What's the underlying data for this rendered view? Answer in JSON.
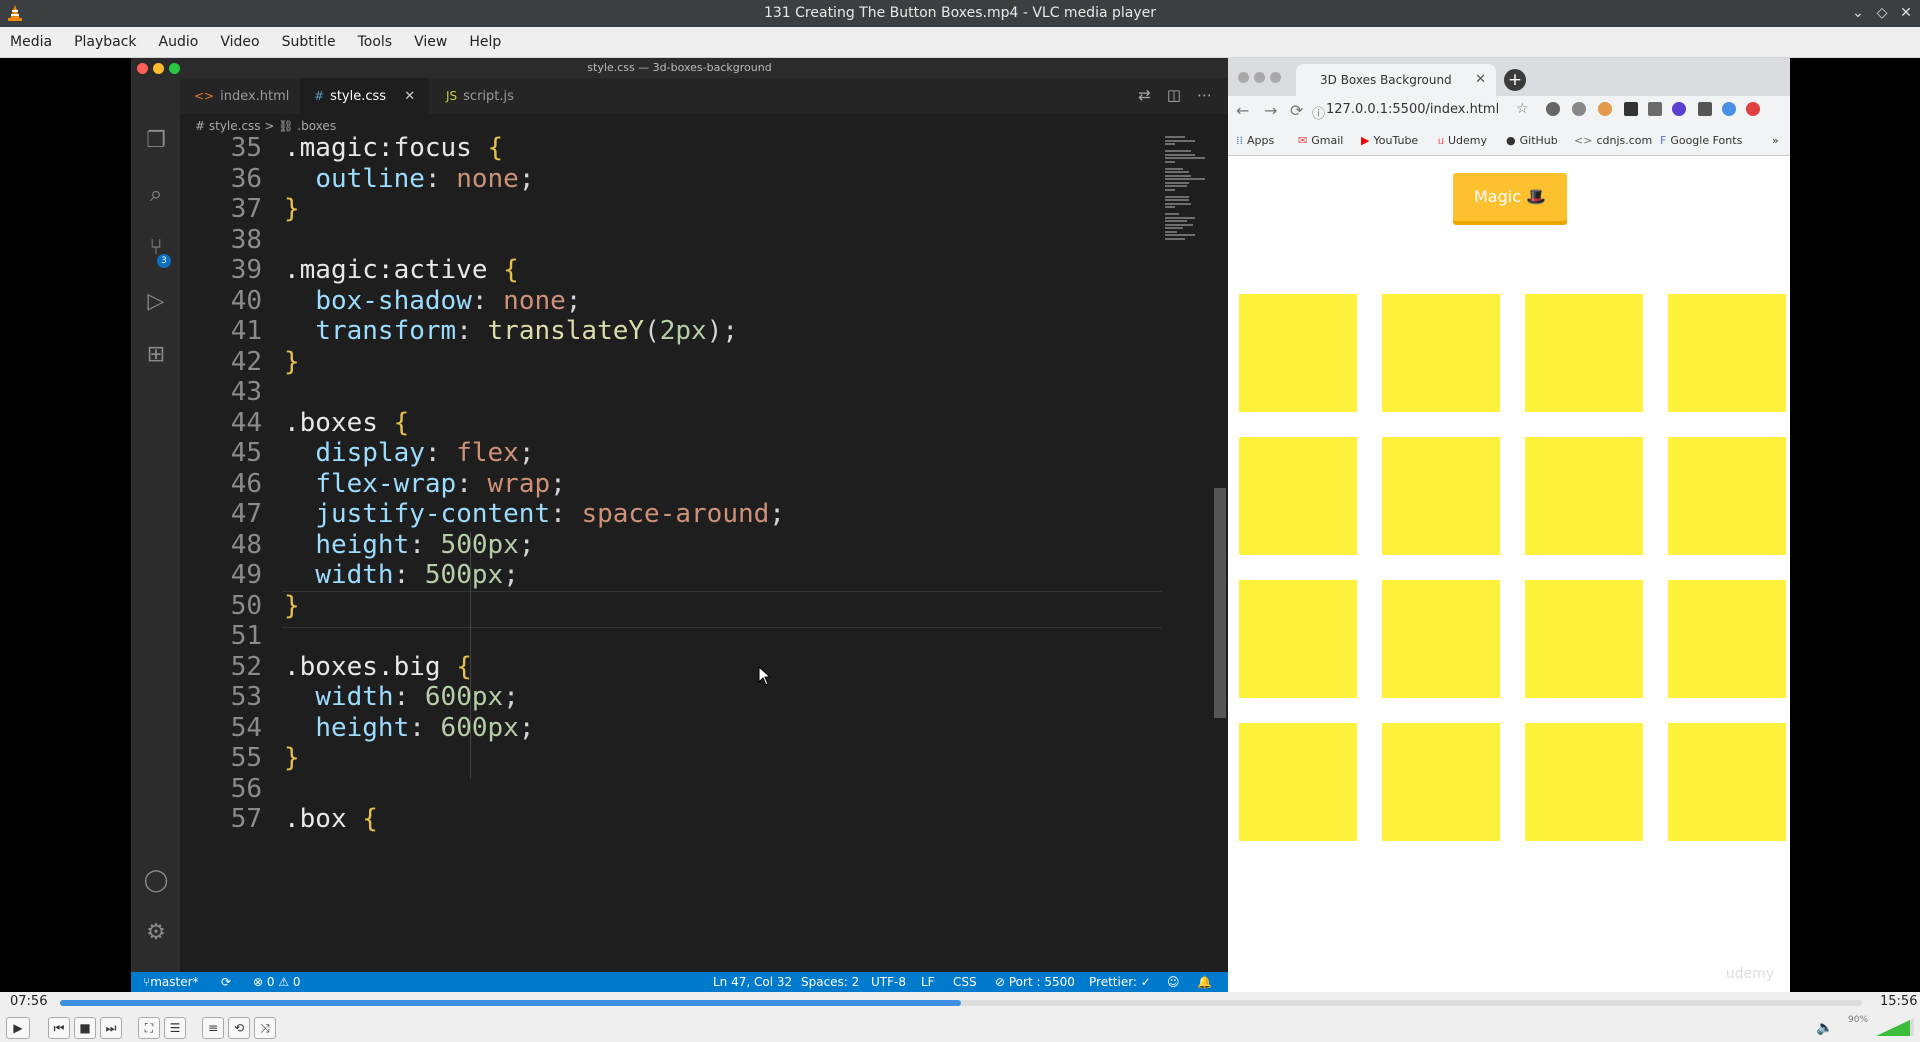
{
  "window": {
    "title": "131 Creating The Button Boxes.mp4 - VLC media player"
  },
  "menu": [
    "Media",
    "Playback",
    "Audio",
    "Video",
    "Subtitle",
    "Tools",
    "View",
    "Help"
  ],
  "editor": {
    "window_title": "style.css — 3d-boxes-background",
    "tabs": [
      {
        "label": "index.html",
        "icon": "<>"
      },
      {
        "label": "style.css",
        "icon": "#"
      },
      {
        "label": "script.js",
        "icon": "JS"
      }
    ],
    "breadcrumb": "# style.css > ⛓ .boxes",
    "scm_badge": "3",
    "lines": [
      {
        "n": "35",
        "html": "<span class='sel'>.magic:focus</span> <span class='brace'>{</span>"
      },
      {
        "n": "36",
        "html": "  <span class='prop'>outline</span><span class='plain'>:</span> <span class='val'>none</span><span class='plain'>;</span>"
      },
      {
        "n": "37",
        "html": "<span class='brace'>}</span>"
      },
      {
        "n": "38",
        "html": ""
      },
      {
        "n": "39",
        "html": "<span class='sel'>.magic:active</span> <span class='brace'>{</span>"
      },
      {
        "n": "40",
        "html": "  <span class='prop'>box-shadow</span><span class='plain'>:</span> <span class='val'>none</span><span class='plain'>;</span>"
      },
      {
        "n": "41",
        "html": "  <span class='prop'>transform</span><span class='plain'>:</span> <span class='fn'>translateY</span><span class='plain'>(</span><span class='num'>2px</span><span class='plain'>);</span>"
      },
      {
        "n": "42",
        "html": "<span class='brace'>}</span>"
      },
      {
        "n": "43",
        "html": ""
      },
      {
        "n": "44",
        "html": "<span class='sel'>.boxes</span> <span class='brace'>{</span>"
      },
      {
        "n": "45",
        "html": "  <span class='prop'>display</span><span class='plain'>:</span> <span class='val'>flex</span><span class='plain'>;</span>"
      },
      {
        "n": "46",
        "html": "  <span class='prop'>flex-wrap</span><span class='plain'>:</span> <span class='val'>wrap</span><span class='plain'>;</span>"
      },
      {
        "n": "47",
        "html": "  <span class='prop'>justify-content</span><span class='plain'>:</span> <span class='val'>space-around</span><span class='plain'>;</span>"
      },
      {
        "n": "48",
        "html": "  <span class='prop'>height</span><span class='plain'>:</span> <span class='num'>500px</span><span class='plain'>;</span>"
      },
      {
        "n": "49",
        "html": "  <span class='prop'>width</span><span class='plain'>:</span> <span class='num'>500px</span><span class='plain'>;</span>"
      },
      {
        "n": "50",
        "html": "<span class='brace'>}</span>"
      },
      {
        "n": "51",
        "html": ""
      },
      {
        "n": "52",
        "html": "<span class='sel'>.boxes.big</span> <span class='brace'>{</span>"
      },
      {
        "n": "53",
        "html": "  <span class='prop'>width</span><span class='plain'>:</span> <span class='num'>600px</span><span class='plain'>;</span>"
      },
      {
        "n": "54",
        "html": "  <span class='prop'>height</span><span class='plain'>:</span> <span class='num'>600px</span><span class='plain'>;</span>"
      },
      {
        "n": "55",
        "html": "<span class='brace'>}</span>"
      },
      {
        "n": "56",
        "html": ""
      },
      {
        "n": "57",
        "html": "<span class='sel'>.box</span> <span class='brace'>{</span>"
      }
    ],
    "status": {
      "branch": "master*",
      "problems": "⊗ 0 ⚠ 0",
      "position": "Ln 47, Col 32",
      "spaces": "Spaces: 2",
      "encoding": "UTF-8",
      "eol": "LF",
      "language": "CSS",
      "port": "⊘ Port : 5500",
      "prettier": "Prettier: ✓"
    }
  },
  "browser": {
    "tab_title": "3D Boxes Background",
    "url": "127.0.0.1:5500/index.html",
    "bookmarks": [
      "Apps",
      "Gmail",
      "YouTube",
      "Udemy",
      "GitHub",
      "cdnjs.com",
      "Google Fonts"
    ],
    "magic_button": "Magic 🎩",
    "box_color": "#fff23d",
    "watermark": "udemy"
  },
  "player": {
    "elapsed": "07:56",
    "total": "15:56",
    "progress": 0.5,
    "volume": "90%"
  }
}
